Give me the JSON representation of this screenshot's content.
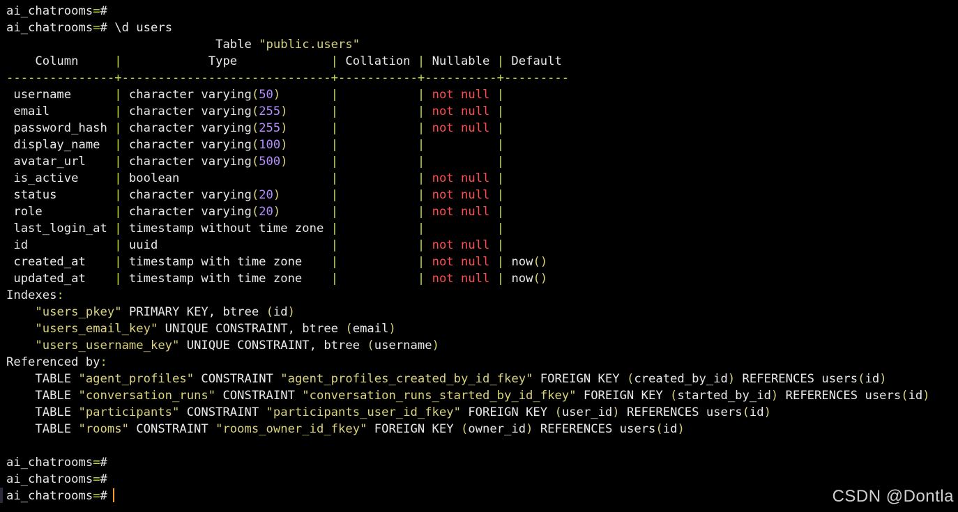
{
  "prompt": "ai_chatrooms=#",
  "command": "\\d users",
  "table_title": {
    "prefix": "Table ",
    "name": "\"public.users\""
  },
  "header": {
    "column": "Column",
    "type": "Type",
    "collation": "Collation",
    "nullable": "Nullable",
    "default": "Default"
  },
  "separator_line": "---------------+-----------------------------+-----------+----------+---------",
  "columns": [
    {
      "name": "username",
      "type_text": "character varying",
      "type_arg": "50",
      "nullable": "not null",
      "default": ""
    },
    {
      "name": "email",
      "type_text": "character varying",
      "type_arg": "255",
      "nullable": "not null",
      "default": ""
    },
    {
      "name": "password_hash",
      "type_text": "character varying",
      "type_arg": "255",
      "nullable": "not null",
      "default": ""
    },
    {
      "name": "display_name",
      "type_text": "character varying",
      "type_arg": "100",
      "nullable": "",
      "default": ""
    },
    {
      "name": "avatar_url",
      "type_text": "character varying",
      "type_arg": "500",
      "nullable": "",
      "default": ""
    },
    {
      "name": "is_active",
      "type_text": "boolean",
      "type_arg": "",
      "nullable": "not null",
      "default": ""
    },
    {
      "name": "status",
      "type_text": "character varying",
      "type_arg": "20",
      "nullable": "not null",
      "default": ""
    },
    {
      "name": "role",
      "type_text": "character varying",
      "type_arg": "20",
      "nullable": "not null",
      "default": ""
    },
    {
      "name": "last_login_at",
      "type_text": "timestamp without time zone",
      "type_arg": "",
      "nullable": "",
      "default": ""
    },
    {
      "name": "id",
      "type_text": "uuid",
      "type_arg": "",
      "nullable": "not null",
      "default": ""
    },
    {
      "name": "created_at",
      "type_text": "timestamp with time zone",
      "type_arg": "",
      "nullable": "not null",
      "default": "now"
    },
    {
      "name": "updated_at",
      "type_text": "timestamp with time zone",
      "type_arg": "",
      "nullable": "not null",
      "default": "now"
    }
  ],
  "indexes_label": "Indexes",
  "indexes": [
    {
      "name": "\"users_pkey\"",
      "desc": " PRIMARY KEY, btree ",
      "col": "id"
    },
    {
      "name": "\"users_email_key\"",
      "desc": " UNIQUE CONSTRAINT, btree ",
      "col": "email"
    },
    {
      "name": "\"users_username_key\"",
      "desc": " UNIQUE CONSTRAINT, btree ",
      "col": "username"
    }
  ],
  "referenced_label": "Referenced by",
  "references": [
    {
      "table": "\"agent_profiles\"",
      "constraint": "\"agent_profiles_created_by_id_fkey\"",
      "fk_col": "created_by_id",
      "ref": "users",
      "ref_col": "id"
    },
    {
      "table": "\"conversation_runs\"",
      "constraint": "\"conversation_runs_started_by_id_fkey\"",
      "fk_col": "started_by_id",
      "ref": "users",
      "ref_col": "id"
    },
    {
      "table": "\"participants\"",
      "constraint": "\"participants_user_id_fkey\"",
      "fk_col": "user_id",
      "ref": "users",
      "ref_col": "id"
    },
    {
      "table": "\"rooms\"",
      "constraint": "\"rooms_owner_id_fkey\"",
      "fk_col": "owner_id",
      "ref": "users",
      "ref_col": "id"
    }
  ],
  "watermark": "CSDN @Dontla",
  "colors": {
    "background": "#000000",
    "text": "#e8e8e8",
    "prompt_symbol": "#c4dc3a",
    "string": "#d9d27a",
    "number": "#b28bff",
    "not_null": "#ff4c4c",
    "cursor": "#ff9c1a"
  }
}
